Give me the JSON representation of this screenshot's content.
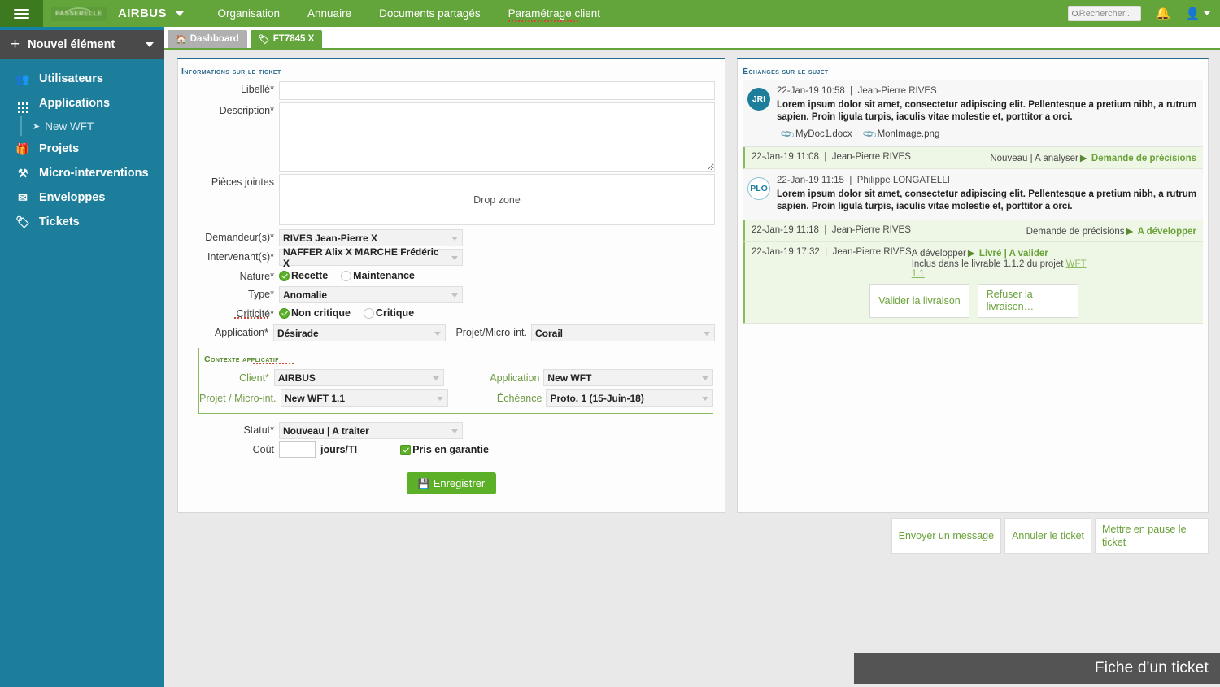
{
  "topbar": {
    "hamburger_icon": "hamburger-icon",
    "logo_text": "PASSERELLE",
    "client_name": "AIRBUS",
    "nav": [
      {
        "label": "Organisation"
      },
      {
        "label": "Annuaire"
      },
      {
        "label": "Documents partagés"
      },
      {
        "label": "Paramétrage client"
      }
    ],
    "search_placeholder": "Rechercher...",
    "bell_icon": "bell-icon",
    "user_icon": "user-icon"
  },
  "sidebar": {
    "new_item_label": "Nouvel élément",
    "items": [
      {
        "label": "Utilisateurs",
        "icon": "users-icon"
      },
      {
        "label": "Applications",
        "icon": "grid-icon"
      },
      {
        "label": "New WFT",
        "icon": "pin-icon",
        "sub": true
      },
      {
        "label": "Projets",
        "icon": "box-icon"
      },
      {
        "label": "Micro-interventions",
        "icon": "tools-icon"
      },
      {
        "label": "Enveloppes",
        "icon": "envelope-icon"
      },
      {
        "label": "Tickets",
        "icon": "tag-icon"
      }
    ]
  },
  "tabs": [
    {
      "label": "Dashboard",
      "icon": "home-icon",
      "active": false
    },
    {
      "label": "FT7845 X",
      "icon": "tag-icon",
      "active": true
    }
  ],
  "left_panel": {
    "title": "Informations sur le ticket",
    "fields": {
      "libelle_label": "Libellé*",
      "libelle_value": "",
      "description_label": "Description*",
      "description_value": "",
      "attachments_label": "Pièces jointes",
      "dropzone_text": "Drop zone",
      "demandeur_label": "Demandeur(s)*",
      "demandeur_value": "RIVES Jean-Pierre X",
      "intervenant_label": "Intervenant(s)*",
      "intervenant_value": "NAFFER Alix X  MARCHE Frédéric X",
      "nature_label": "Nature*",
      "nature_options": [
        {
          "label": "Recette",
          "checked": true
        },
        {
          "label": "Maintenance",
          "checked": false
        }
      ],
      "type_label": "Type*",
      "type_value": "Anomalie",
      "criticite_label": "Criticité*",
      "criticite_options": [
        {
          "label": "Non critique",
          "checked": true
        },
        {
          "label": "Critique",
          "checked": false
        }
      ],
      "application_label": "Application*",
      "application_value": "Désirade",
      "projet_micro_label": "Projet/Micro-int.",
      "projet_micro_value": "Corail",
      "statut_label": "Statut*",
      "statut_value": "Nouveau | A traiter",
      "cout_label": "Coût",
      "cout_value": "",
      "cout_unit": "jours/TI",
      "garantie_label": "Pris en garantie",
      "garantie_checked": true,
      "save_label": "Enregistrer"
    },
    "context": {
      "title": "Contexte applicatif",
      "client_label": "Client*",
      "client_value": "AIRBUS",
      "projet_label": "Projet / Micro-int.",
      "projet_value": "New WFT 1.1",
      "application_label": "Application",
      "application_value": "New WFT",
      "echeance_label": "Échéance",
      "echeance_value": "Proto. 1 (15-Juin-18)"
    }
  },
  "right_panel": {
    "title": "Échanges sur le sujet",
    "entries": [
      {
        "kind": "message",
        "avatar": "JRI",
        "avatar_style": "filled",
        "date": "22-Jan-19",
        "time": "10:58",
        "author": "Jean-Pierre RIVES",
        "text": "Lorem ipsum dolor sit amet, consectetur adipiscing elit. Pellentesque a pretium nibh, a rutrum sapien. Proin ligula turpis, iaculis vitae molestie et, porttitor a orci.",
        "attachments": [
          {
            "name": "MyDoc1.docx"
          },
          {
            "name": "MonImage.png"
          }
        ]
      },
      {
        "kind": "status",
        "date": "22-Jan-19",
        "time": "11:08",
        "author": "Jean-Pierre RIVES",
        "from_status": "Nouveau | A analyser",
        "to_status": "Demande de précisions"
      },
      {
        "kind": "message",
        "avatar": "PLO",
        "avatar_style": "outline",
        "date": "22-Jan-19",
        "time": "11:15",
        "author": "Philippe LONGATELLI",
        "text": "Lorem ipsum dolor sit amet, consectetur adipiscing elit. Pellentesque a pretium nibh, a rutrum sapien. Proin ligula turpis, iaculis vitae molestie et, porttitor a orci.",
        "attachments": []
      },
      {
        "kind": "status",
        "date": "22-Jan-19",
        "time": "11:18",
        "author": "Jean-Pierre RIVES",
        "from_status": "Demande de précisions",
        "to_status": "A développer"
      },
      {
        "kind": "status-actions",
        "date": "22-Jan-19",
        "time": "17:32",
        "author": "Jean-Pierre RIVES",
        "from_status": "A développer",
        "to_status": "Livré | A valider",
        "deliverable_prefix": "Inclus dans le livrable 1.1.2 du projet ",
        "deliverable_link": "WFT 1.1",
        "actions": [
          {
            "label": "Valider la livraison"
          },
          {
            "label": "Refuser la livraison…"
          }
        ]
      }
    ]
  },
  "bottom_buttons": [
    {
      "label": "Envoyer un message"
    },
    {
      "label": "Annuler le ticket"
    },
    {
      "label": "Mettre en pause le ticket"
    }
  ],
  "caption": "Fiche d'un ticket",
  "colors": {
    "brand_green": "#63a53b",
    "sidebar_teal": "#1d7e9c",
    "panel_accent": "#2b6a8f",
    "status_green": "#6aa23a",
    "check_green": "#5cb028"
  }
}
